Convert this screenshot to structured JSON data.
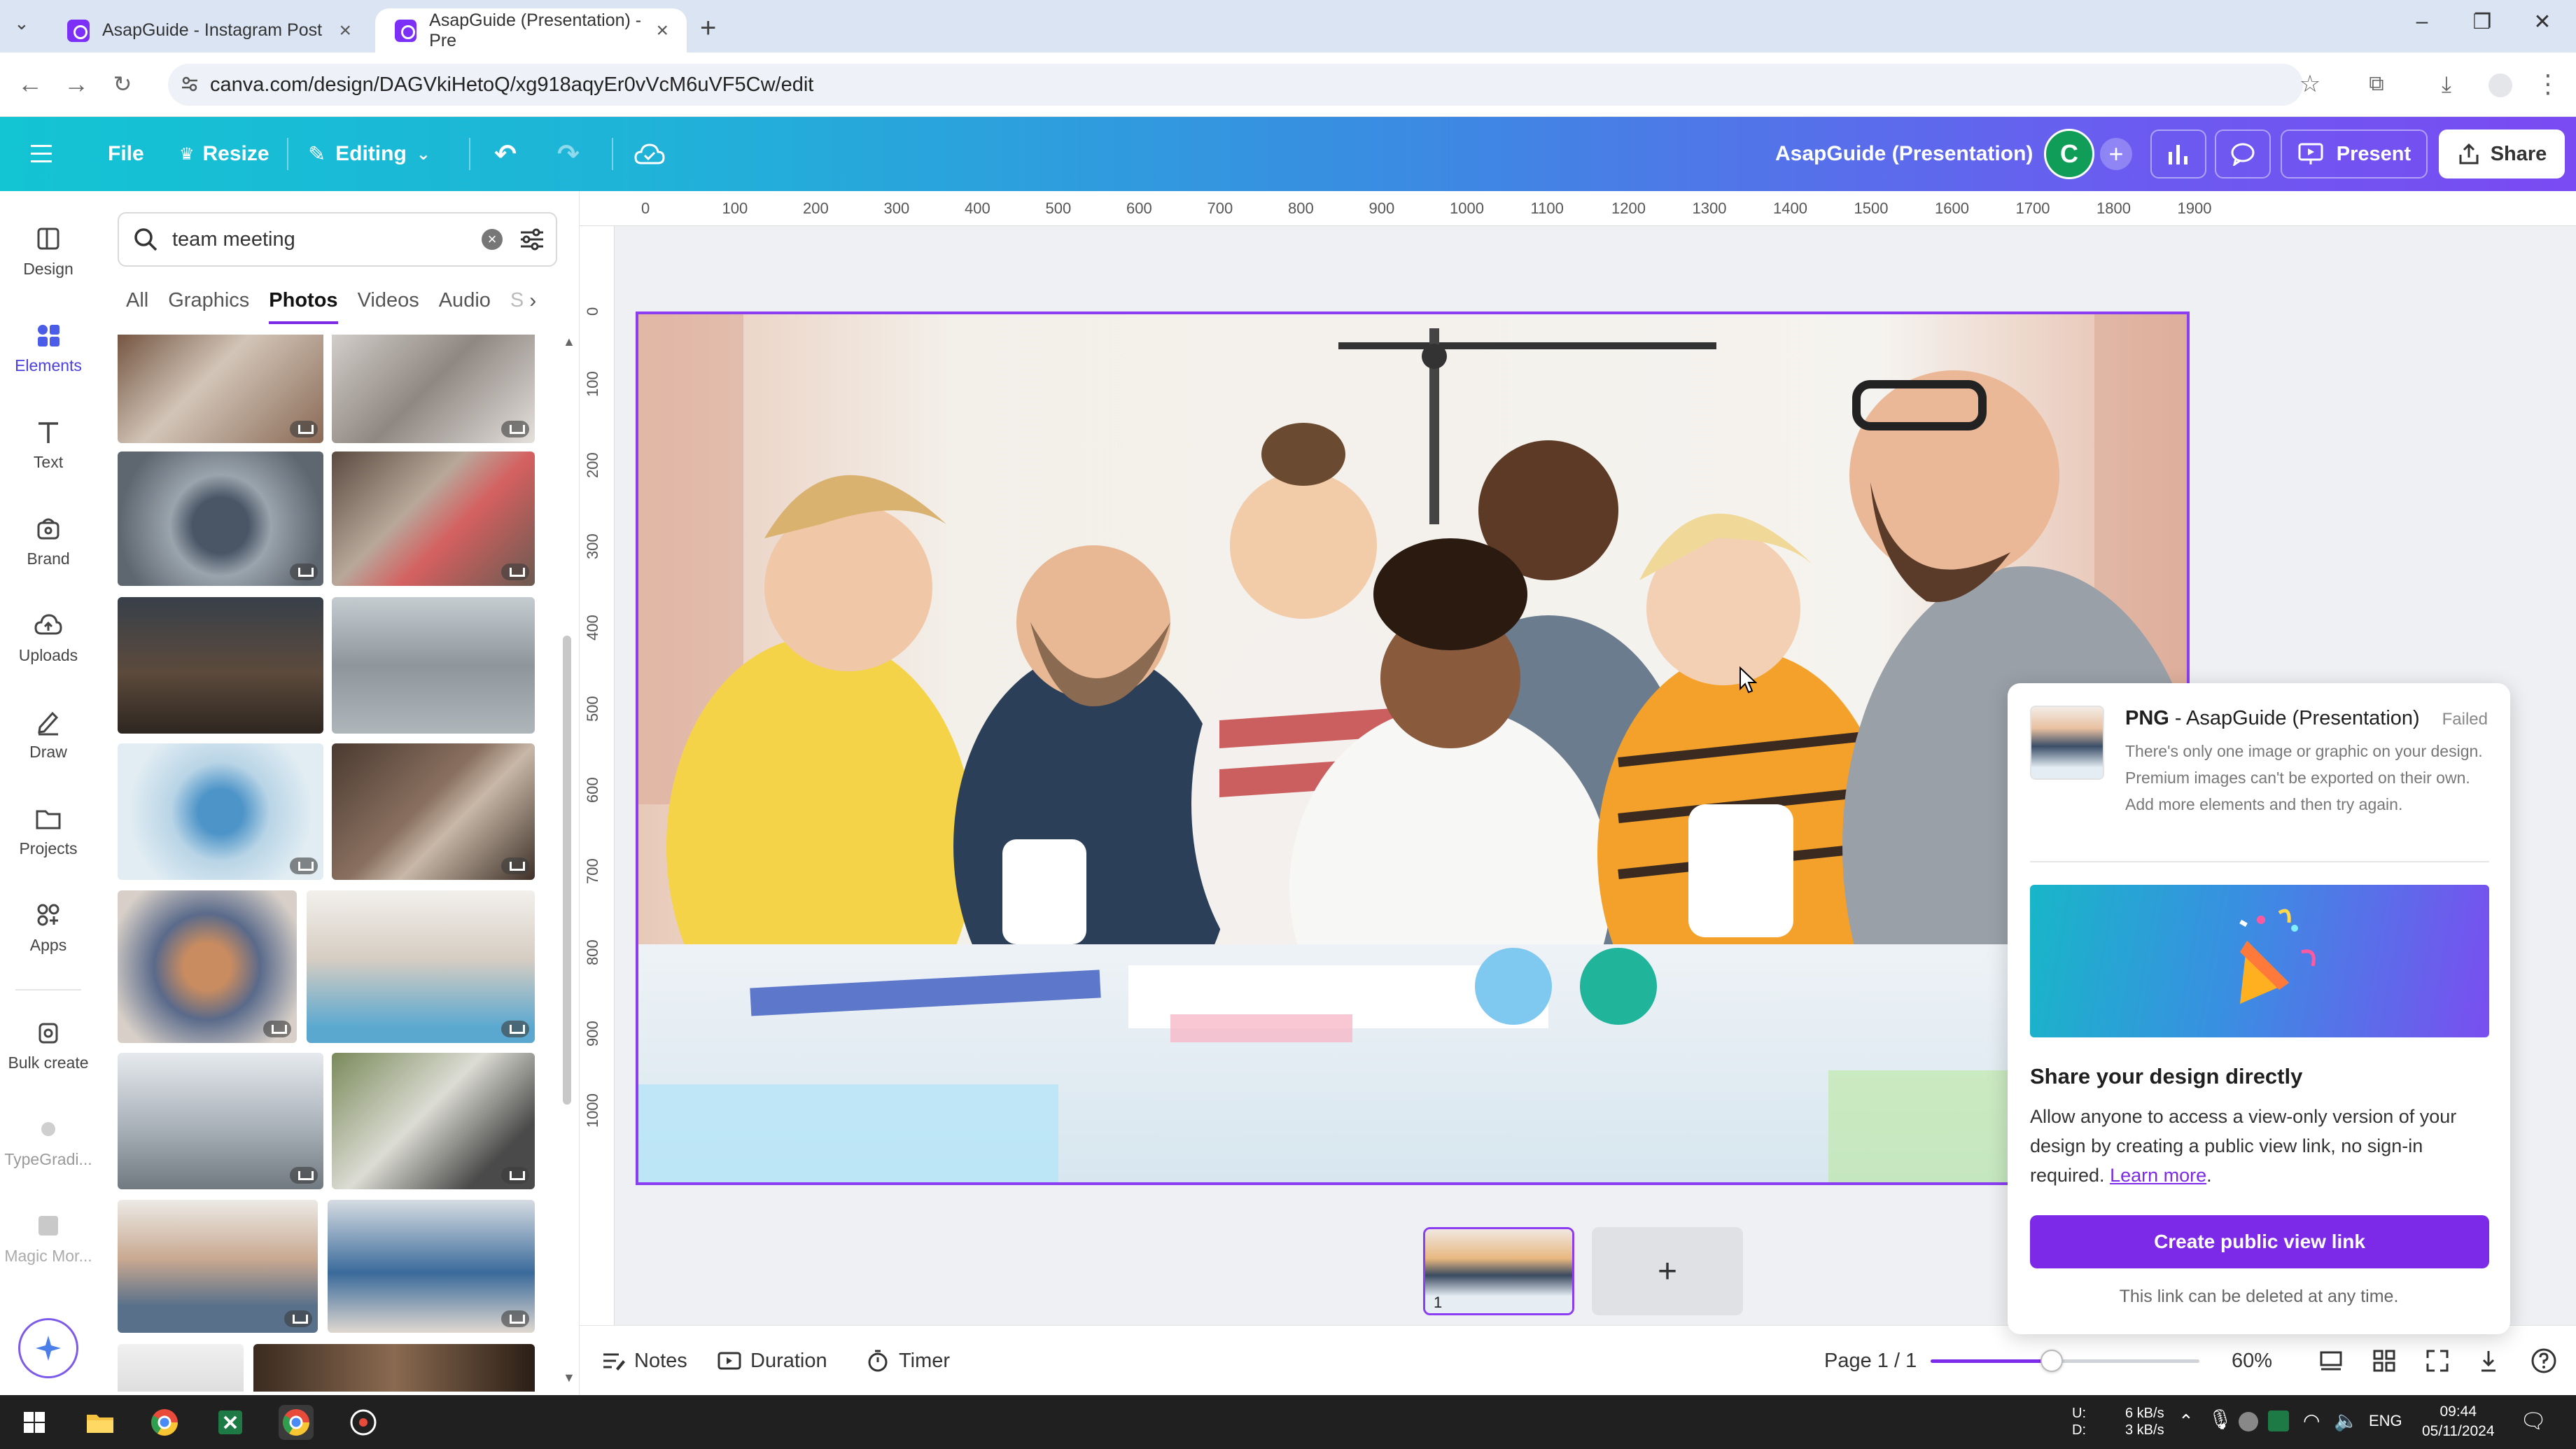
{
  "browser": {
    "tabs": [
      {
        "title": "AsapGuide - Instagram Post",
        "active": false
      },
      {
        "title": "AsapGuide (Presentation) - Pre",
        "active": true
      }
    ],
    "url": "canva.com/design/DAGVkiHetoQ/xg918aqyEr0vVcM6uVF5Cw/edit"
  },
  "header": {
    "file_label": "File",
    "resize_label": "Resize",
    "editing_label": "Editing",
    "doc_title": "AsapGuide (Presentation)",
    "avatar_letter": "C",
    "present_label": "Present",
    "share_label": "Share"
  },
  "sidebar": {
    "items": [
      {
        "label": "Design",
        "icon": "layout-icon"
      },
      {
        "label": "Elements",
        "icon": "elements-icon"
      },
      {
        "label": "Text",
        "icon": "text-icon"
      },
      {
        "label": "Brand",
        "icon": "brand-icon"
      },
      {
        "label": "Uploads",
        "icon": "upload-cloud-icon"
      },
      {
        "label": "Draw",
        "icon": "pen-icon"
      },
      {
        "label": "Projects",
        "icon": "folder-icon"
      },
      {
        "label": "Apps",
        "icon": "apps-icon"
      },
      {
        "label": "Bulk create",
        "icon": "bulk-create-icon"
      },
      {
        "label": "TypeGradi...",
        "icon": "typegradient-icon"
      },
      {
        "label": "Magic Mor...",
        "icon": "magic-morph-icon"
      }
    ]
  },
  "panel": {
    "search_value": "team meeting",
    "filter_tabs": [
      "All",
      "Graphics",
      "Photos",
      "Videos",
      "Audio",
      "S"
    ],
    "active_filter": "Photos"
  },
  "ruler": {
    "h": [
      "0",
      "100",
      "200",
      "300",
      "400",
      "500",
      "600",
      "700",
      "800",
      "900",
      "1000",
      "1100",
      "1200",
      "1300",
      "1400",
      "1500",
      "1600",
      "1700",
      "1800",
      "1900"
    ],
    "v": [
      "0",
      "100",
      "200",
      "300",
      "400",
      "500",
      "600",
      "700",
      "800",
      "900",
      "1000"
    ]
  },
  "page_thumb_number": "1",
  "popup": {
    "format": "PNG",
    "file_title": " - AsapGuide (Presentation)",
    "status": "Failed",
    "message": "There's only one image or graphic on your design. Premium images can't be exported on their own. Add more elements and then try again.",
    "share_heading": "Share your design directly",
    "share_text": "Allow anyone to access a view-only version of your design by creating a public view link, no sign-in required.",
    "learn_more": "Learn more",
    "create_button": "Create public view link",
    "footnote": "This link can be deleted at any time."
  },
  "bottombar": {
    "notes": "Notes",
    "duration": "Duration",
    "timer": "Timer",
    "page": "Page 1 / 1",
    "zoom": "60%",
    "zoom_fraction": 0.45
  },
  "taskbar": {
    "net_up_label": "U:",
    "net_down_label": "D:",
    "net_up": "6 kB/s",
    "net_down": "3 kB/s",
    "lang": "ENG",
    "time": "09:44",
    "date": "05/11/2024"
  },
  "colors": {
    "accent_purple": "#7d2ae8",
    "header_gradient_start": "#13c4d3",
    "header_gradient_end": "#7a4af2",
    "avatar_green": "#0f9d58",
    "status_failed": "#888888"
  }
}
